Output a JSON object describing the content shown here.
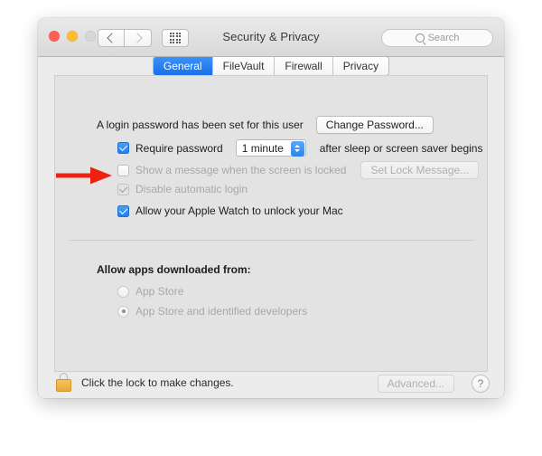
{
  "window": {
    "title": "Security & Privacy",
    "traffic_lights": [
      "close",
      "minimize",
      "zoom"
    ],
    "nav": {
      "back": "back-arrow",
      "forward": "forward-arrow",
      "show_all": "grid-icon"
    },
    "search": {
      "placeholder": "Search",
      "icon": "search-icon",
      "value": ""
    }
  },
  "tabs": [
    {
      "label": "General",
      "active": true
    },
    {
      "label": "FileVault",
      "active": false
    },
    {
      "label": "Firewall",
      "active": false
    },
    {
      "label": "Privacy",
      "active": false
    }
  ],
  "general": {
    "login_password_text": "A login password has been set for this user",
    "change_password_button": "Change Password...",
    "require_password": {
      "label": "Require password",
      "checked": true,
      "enabled": true,
      "delay_value": "1 minute",
      "suffix": "after sleep or screen saver begins"
    },
    "show_message": {
      "label": "Show a message when the screen is locked",
      "checked": false,
      "enabled": false,
      "button": "Set Lock Message..."
    },
    "disable_auto_login": {
      "label": "Disable automatic login",
      "checked": true,
      "enabled": false
    },
    "apple_watch": {
      "label": "Allow your Apple Watch to unlock your Mac",
      "checked": true,
      "enabled": true,
      "annotated": true
    },
    "allow_apps": {
      "heading": "Allow apps downloaded from:",
      "options": [
        {
          "label": "App Store",
          "selected": false,
          "enabled": false
        },
        {
          "label": "App Store and identified developers",
          "selected": true,
          "enabled": false
        }
      ]
    }
  },
  "footer": {
    "lock_icon": "lock-closed-icon",
    "lock_text": "Click the lock to make changes.",
    "advanced_button": "Advanced...",
    "help_button": "?"
  },
  "annotation": {
    "type": "arrow",
    "color": "#ee2211",
    "points_to": "apple-watch-checkbox"
  },
  "colors": {
    "accent_blue": "#2b84ef",
    "window_chrome": "#e3e3e3",
    "panel_bg": "#e3e3e3",
    "lock_gold": "#e8a93c",
    "annotation_red": "#ee2211"
  }
}
